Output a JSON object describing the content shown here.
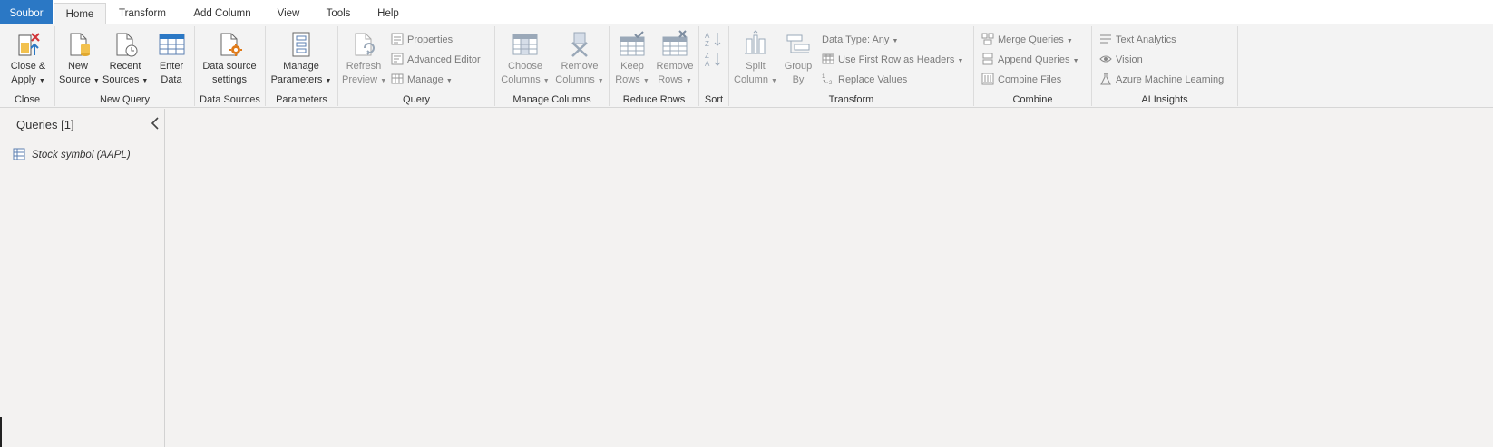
{
  "menu": {
    "tabs": [
      "Soubor",
      "Home",
      "Transform",
      "Add Column",
      "View",
      "Tools",
      "Help"
    ],
    "active_tab": "Home"
  },
  "ribbon": {
    "groups": {
      "close": {
        "label": "Close",
        "close_apply": [
          "Close &",
          "Apply"
        ]
      },
      "new_query": {
        "label": "New Query",
        "new_source": [
          "New",
          "Source"
        ],
        "recent_sources": [
          "Recent",
          "Sources"
        ],
        "enter_data": [
          "Enter",
          "Data"
        ]
      },
      "data_sources": {
        "label": "Data Sources",
        "settings": [
          "Data source",
          "settings"
        ]
      },
      "parameters": {
        "label": "Parameters",
        "manage": [
          "Manage",
          "Parameters"
        ]
      },
      "query": {
        "label": "Query",
        "refresh": [
          "Refresh",
          "Preview"
        ],
        "properties": "Properties",
        "advanced_editor": "Advanced Editor",
        "manage": "Manage"
      },
      "manage_columns": {
        "label": "Manage Columns",
        "choose": [
          "Choose",
          "Columns"
        ],
        "remove": [
          "Remove",
          "Columns"
        ]
      },
      "reduce_rows": {
        "label": "Reduce Rows",
        "keep": [
          "Keep",
          "Rows"
        ],
        "remove": [
          "Remove",
          "Rows"
        ]
      },
      "sort": {
        "label": "Sort"
      },
      "transform": {
        "label": "Transform",
        "split": [
          "Split",
          "Column"
        ],
        "group": [
          "Group",
          "By"
        ],
        "data_type": "Data Type: Any",
        "first_row": "Use First Row as Headers",
        "replace": "Replace Values"
      },
      "combine": {
        "label": "Combine",
        "merge": "Merge Queries",
        "append": "Append Queries",
        "combine_files": "Combine Files"
      },
      "ai": {
        "label": "AI Insights",
        "text_analytics": "Text Analytics",
        "vision": "Vision",
        "azure_ml": "Azure Machine Learning"
      }
    }
  },
  "queries": {
    "header": "Queries [1]",
    "items": [
      "Stock symbol (AAPL)"
    ]
  },
  "colors": {
    "file_tab": "#2b78c5",
    "ribbon_bg": "#f3f3f3",
    "canvas_bg": "#f3f2f1",
    "accent_orange": "#e07b1a",
    "icon_blue": "#5b7fb0"
  }
}
